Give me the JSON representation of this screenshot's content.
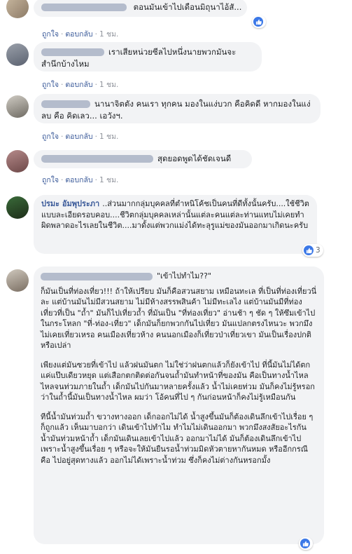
{
  "actions": {
    "like": "ถูกใจ",
    "reply": "ตอบกลับ",
    "time": "1 ชม."
  },
  "comments": [
    {
      "text": "ตอนมันเข้าไปเดือนมิถุนาไอ้สั..."
    },
    {
      "text": "เราเสียหน่วยซีลไปหนึ่งนายพวกมันจะสำนึกบ้างไหม"
    },
    {
      "text": "นานาจิตตัง คนเรา ทุกคน มองในแง่บวก คือคิดดี หากมองในแง่ลบ คือ คิดเลว... เอวังฯ."
    },
    {
      "text": "สุดยอดพูดได้ชัดเจนดี"
    },
    {
      "name": "ปรมะ อัมพุประภา",
      "text": "..ส่วนมากกลุ่มบุคคลที่ตำหนิโค้ชเป็นคนที่ดีทั้งนั้นครับ....ใช้ชีวิตแบบละเอียดรอบคอบ....ชีวิตกลุ่มบุคคลเหล่านั้นแต่ละคนแต่ละท่านแทบไม่เคยทำผิดพลาดอะไรเลยในชีวิต....มาดั้งแต่พวกแม่งได้ทะลุรูแม่ของมันออกมาเกิดนะครับ",
      "reaction_count": "3"
    },
    {
      "quote": "\"เข้าไปทำไม??\"",
      "paragraphs": [
        "ก็มันเป็นที่ท่องเที่ยว!!! ถ้าให้เปรียบ มันก็คือสวนสยาม เหมือนทะเล ที่เป็นที่ท่องเที่ยวนี่ละ แต่บ้านมันไม่มีสวนสยาม ไม่มีห้างสรรพสินค้า ไม่มีทะเลไง แต่บ้านมันมีที่ท่องเที่ยวที่เป็น \"ถ้ำ\" มันก็ไปเที่ยวถ้ำ ที่มันเป็น \"ที่ท่องเที่ยว\" อ่านช้า ๆ ชัด ๆ ให้ซึมเข้าไปในกระโหลก \"ที่-ท่อง-เที่ยว\" เด็กมันก็ยกพวกกันไปเที่ยว มันแปลกตรงไหนวะ พวกมึงไม่เคยเที่ยวเหรอ คนเมืองเที่ยวห้าง คนนอกเมืองก็เที่ยวป่าเที่ยวเขา มันเป็นเรื่องปกติหรือเปล่า",
        "เพียงแต่มันซวยที่เข้าไป แล้วฝนมันตก ไม่ใช่ว่าฝนตกแล้วก็ยังเข้าไป ที่นี้มันไม่ได้ตกแค่แป๊บเดียวหยุด แต่เสือกตกติดต่อกันจนถ้ำมันทำหน้าที่ของมัน คือเป็นทางน้ำไหล ไหลจนท่วมภายในถ้ำ เด็กมันไปกันมาหลายครั้งแล้ว น้ำไม่เคยท่วม มันก็คงไม่รู้หรอกว่าในถ้ำนี้มันเป็นทางน้ำไหล ผมว่า โอ้คนที่ไป ๆ กันก่อนหน้าก็คงไม่รู้เหมือนกัน",
        "ทีนี้น้ำมันท่วมถ้ำ ขวางทางออก เด็กออกไม่ได้ น้ำสูงขึ้นมันก็ต้องเดินลึกเข้าไปเรื่อย ๆ ก็ถูกแล้ว เห็นมาบอกว่า เดินเข้าไปทำไม ทำไมไม่เดินออกมา พวกมึงสงสัยอะไรกัน น้ำมันท่วมหน้าถ้ำ เด็กมันเดินเลยเข้าไปแล้ว ออกมาไม่ได้ มันก็ต้องเดินลึกเข้าไปเพราะน้ำสูงขึ้นเรื่อย ๆ หรือจะให้มันยืนรอน้ำท่วมมิดหัวตายหากันหมด หรืออีกกรณี คือ ไปอยู่สุดทางแล้ว ออกไม่ได้เพราะน้ำท่วม ซึ่งก็คงไม่ต่างกันหรอกมั้ง"
      ],
      "reaction_count": ""
    }
  ]
}
